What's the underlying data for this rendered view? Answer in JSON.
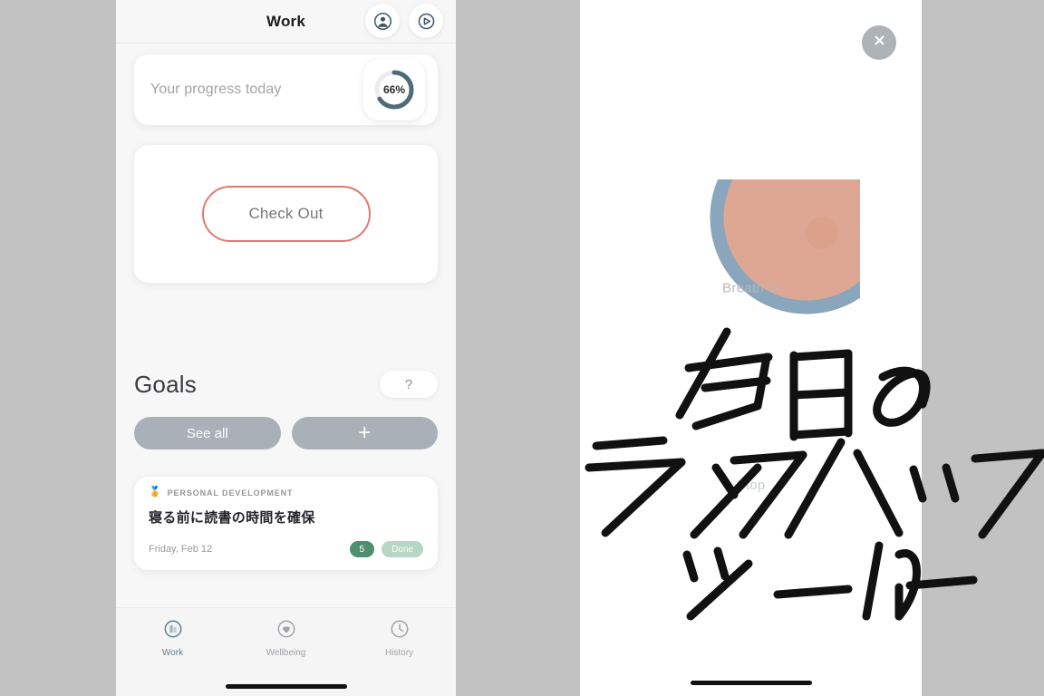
{
  "background": {
    "color": "#c2c2c2"
  },
  "left_phone": {
    "topbar": {
      "title": "Work",
      "account_icon": "account-circle-icon",
      "globe_icon": "globe-play-icon"
    },
    "progress_card": {
      "label": "Your progress today",
      "percent_text": "66%",
      "percent_value": 66,
      "ring_color": "#4d6b78",
      "ring_track_color": "#ecebf1"
    },
    "checkout": {
      "label": "Check Out",
      "border_color": "#e0796d",
      "text_color": "#77777b"
    },
    "goals": {
      "title": "Goals",
      "help_label": "?",
      "see_all_label": "See all",
      "add_label": "+",
      "pill_color": "#a9b0b8"
    },
    "goal_card": {
      "category_icon": "medal-icon",
      "category": "PERSONAL DEVELOPMENT",
      "title": "寝る前に読書の時間を確保",
      "date": "Friday, Feb 12",
      "count_badge": "5",
      "status_badge": "Done",
      "count_badge_color": "#4e8f6e",
      "status_badge_color": "#b7d6c3"
    },
    "bottom_nav": {
      "items": [
        {
          "label": "Work",
          "icon": "work-building-icon",
          "active": true
        },
        {
          "label": "Wellbeing",
          "icon": "heart-circle-icon",
          "active": false
        },
        {
          "label": "History",
          "icon": "clock-icon",
          "active": false
        }
      ],
      "active_color": "#5b7f94",
      "inactive_color": "#a2a2a7"
    }
  },
  "right_phone": {
    "close_icon": "close-x-icon",
    "breath": {
      "label": "Breath in",
      "ring_color": "#7f9fb8",
      "dot_color": "#dca08a",
      "dot_angle_deg": 38
    },
    "stop_label": "Stop"
  },
  "overlay": {
    "line1": "今日の",
    "line2": "ライフハック",
    "line3": "ツールー",
    "ink_color": "#111111"
  }
}
